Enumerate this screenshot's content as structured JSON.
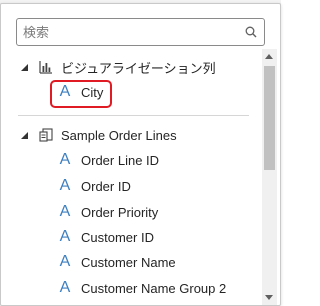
{
  "search": {
    "placeholder": "検索",
    "icon": "search-icon"
  },
  "groups": [
    {
      "label": "ビジュアライゼーション列",
      "icon": "bar-chart-icon",
      "expanded": true,
      "items": [
        {
          "label": "City",
          "icon": "attribute-icon",
          "glyph": "A",
          "highlighted": true
        }
      ]
    },
    {
      "label": "Sample Order Lines",
      "icon": "data-source-icon",
      "expanded": true,
      "items": [
        {
          "label": "Order Line ID",
          "icon": "attribute-icon",
          "glyph": "A"
        },
        {
          "label": "Order ID",
          "icon": "attribute-icon",
          "glyph": "A"
        },
        {
          "label": "Order Priority",
          "icon": "attribute-icon",
          "glyph": "A"
        },
        {
          "label": "Customer ID",
          "icon": "attribute-icon",
          "glyph": "A"
        },
        {
          "label": "Customer Name",
          "icon": "attribute-icon",
          "glyph": "A"
        },
        {
          "label": "Customer Name Group 2",
          "icon": "attribute-icon",
          "glyph": "A"
        }
      ]
    }
  ],
  "colors": {
    "attribute_icon": "#3d7fbf",
    "highlight_border": "#e01b24",
    "text": "#252525"
  }
}
